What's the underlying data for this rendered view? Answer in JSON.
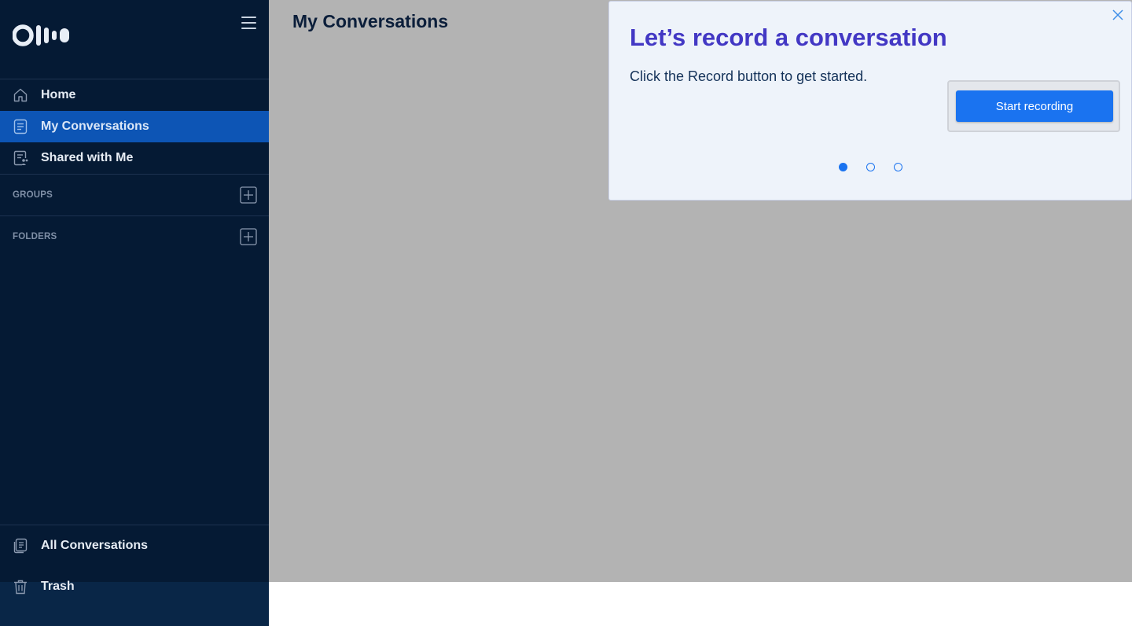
{
  "sidebar": {
    "logo": {
      "icon": "otter-logo-icon"
    },
    "menu_icon": "hamburger-icon",
    "nav": [
      {
        "label": "Home",
        "icon": "home-icon"
      },
      {
        "label": "My Conversations",
        "icon": "conversations-icon",
        "active": true
      },
      {
        "label": "Shared with Me",
        "icon": "shared-icon"
      }
    ],
    "groups": {
      "label": "GROUPS",
      "add_icon": "plus-square-icon"
    },
    "folders": {
      "label": "FOLDERS",
      "add_icon": "plus-square-icon"
    },
    "bottom": [
      {
        "label": "All Conversations",
        "icon": "all-conversations-icon"
      },
      {
        "label": "Trash",
        "icon": "trash-icon"
      }
    ]
  },
  "main": {
    "title": "My Conversations"
  },
  "tour_popover": {
    "title": "Let’s record a conversation",
    "text": "Click the Record button to get started.",
    "button_label": "Start recording",
    "close_icon": "close-icon",
    "steps": 3,
    "active_step": 1
  },
  "colors": {
    "sidebar_bg": "#051a34",
    "active_item": "#0d55b5",
    "overlay": "#b3b3b3",
    "popover_title": "#4338c4",
    "primary_button": "#1a73f0"
  }
}
